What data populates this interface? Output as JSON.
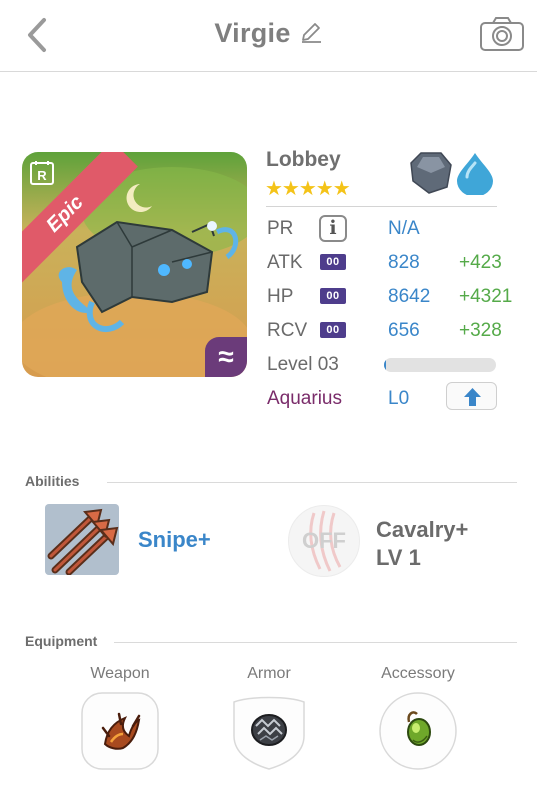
{
  "header": {
    "title": "Virgie"
  },
  "card": {
    "rarity": "Epic",
    "rarity_letter": "R",
    "element_glyph": "≈"
  },
  "creature": {
    "name": "Lobbey",
    "stars": "★★★★★",
    "elements": [
      "stone-element-icon",
      "water-element-icon"
    ]
  },
  "stats": {
    "pr": {
      "label": "PR",
      "info": "i",
      "value": "N/A"
    },
    "atk": {
      "label": "ATK",
      "badge": "00",
      "value": "828",
      "bonus": "+423"
    },
    "hp": {
      "label": "HP",
      "badge": "00",
      "value": "8642",
      "bonus": "+4321"
    },
    "rcv": {
      "label": "RCV",
      "badge": "00",
      "value": "656",
      "bonus": "+328"
    },
    "level": {
      "label": "Level 03",
      "progress": 0.02
    },
    "zodiac": {
      "label": "Aquarius",
      "value": "L0"
    }
  },
  "abilities": {
    "title": "Abilities",
    "items": [
      {
        "name": "Snipe+",
        "icon": "snipe-arrows-icon"
      },
      {
        "name_line1": "Cavalry+",
        "name_line2": "LV 1",
        "status": "OFF",
        "icon": "claw-marks-icon"
      }
    ]
  },
  "equipment": {
    "title": "Equipment",
    "slots": [
      {
        "label": "Weapon",
        "icon": "claw-weapon-icon"
      },
      {
        "label": "Armor",
        "icon": "scale-armor-icon"
      },
      {
        "label": "Accessory",
        "icon": "green-gem-icon"
      }
    ]
  },
  "colors": {
    "accent_blue": "#3a86c9",
    "bonus_green": "#55aa49",
    "zodiac_purple": "#7a2c6a",
    "star_gold": "#f4c318",
    "epic_red": "#e05a69"
  }
}
